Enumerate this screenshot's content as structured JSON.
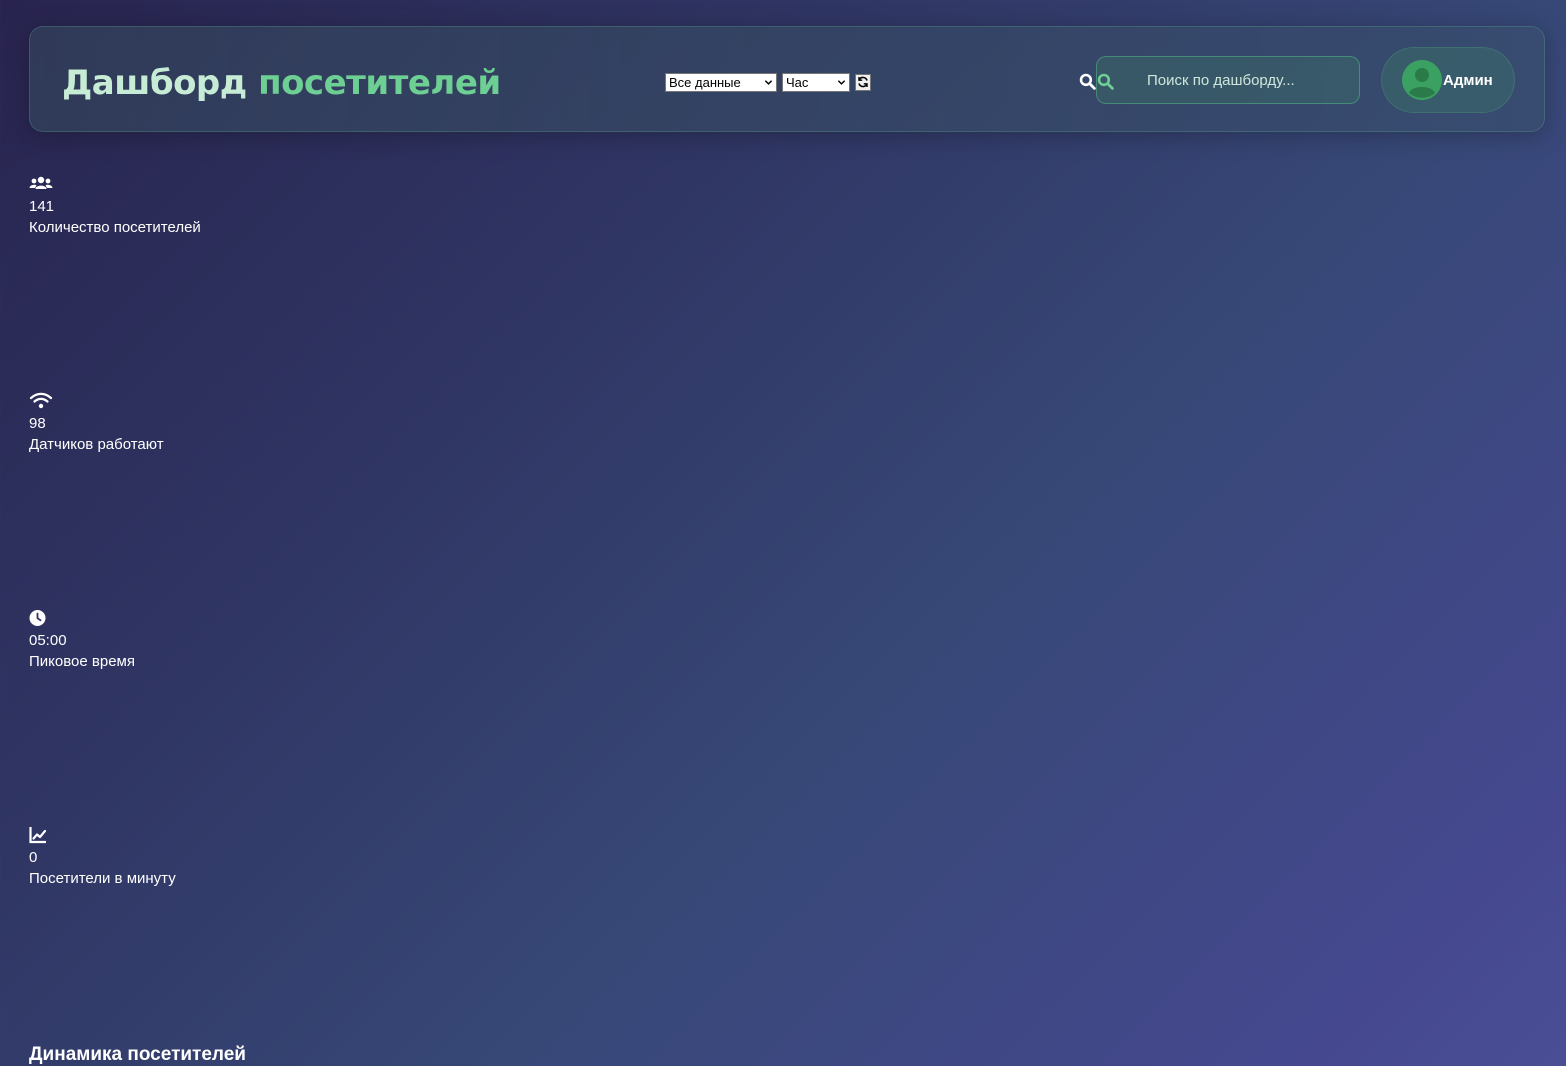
{
  "header": {
    "title_part1": "Дашборд",
    "title_part2": "посетителей",
    "range_select": {
      "selected": "Все данные"
    },
    "interval_select": {
      "selected": "Час"
    },
    "refresh_icon": "refresh-icon",
    "search": {
      "placeholder": "Поиск по дашборду...",
      "icon": "search-icon"
    },
    "user": {
      "name": "Админ",
      "avatar_icon": "user-circle-icon"
    }
  },
  "stats": [
    {
      "icon": "users-icon",
      "value": "141",
      "label": "Количество посетителей"
    },
    {
      "icon": "wifi-icon",
      "value": "98",
      "label": "Датчиков работают"
    },
    {
      "icon": "clock-icon",
      "value": "05:00",
      "label": "Пиковое время"
    },
    {
      "icon": "chart-line-icon",
      "value": "0",
      "label": "Посетители в минуту"
    }
  ],
  "sections": {
    "dynamics_title": "Динамика посетителей"
  },
  "colors": {
    "accent_green": "#6ecf95",
    "title_light": "#c7ecd6",
    "avatar_green": "#3aa163"
  }
}
